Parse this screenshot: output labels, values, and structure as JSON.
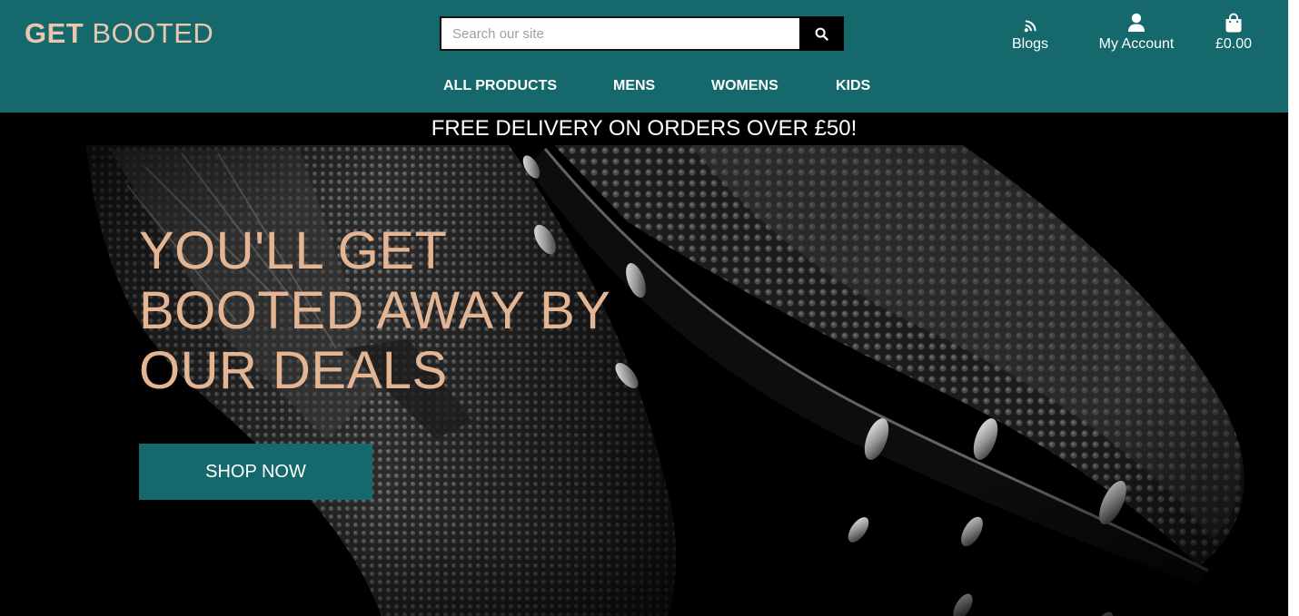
{
  "brand": {
    "logo_bold": "GET",
    "logo_light": "BOOTED",
    "accent_color": "#15686c",
    "logo_color": "#e8c7b0"
  },
  "search": {
    "placeholder": "Search our site",
    "value": "",
    "button_icon": "search-icon"
  },
  "header_links": {
    "blogs": {
      "label": "Blogs",
      "icon": "rss-icon"
    },
    "account": {
      "label": "My Account",
      "icon": "user-icon"
    },
    "bag": {
      "label": "£0.00",
      "icon": "shopping-bag-icon"
    }
  },
  "nav": {
    "items": [
      "ALL PRODUCTS",
      "MENS",
      "WOMENS",
      "KIDS"
    ]
  },
  "banner": {
    "text": "FREE DELIVERY ON ORDERS OVER £50!"
  },
  "hero": {
    "headline_lines": [
      "YOU'LL GET",
      "BOOTED AWAY BY",
      "OUR DEALS"
    ],
    "headline_color": "#e3b593",
    "cta_label": "SHOP NOW"
  }
}
